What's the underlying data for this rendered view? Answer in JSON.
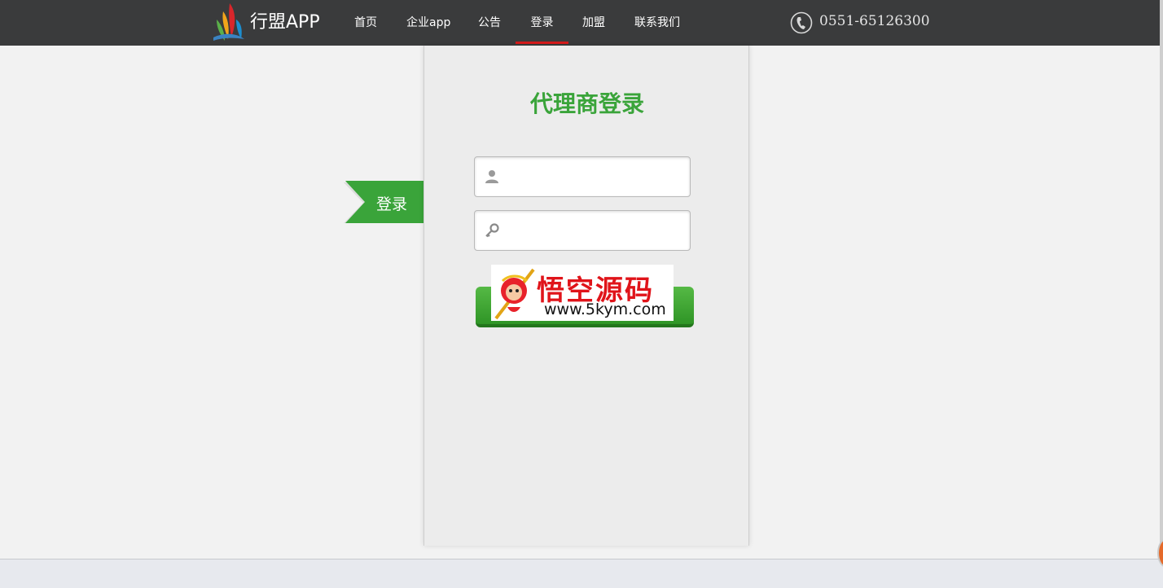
{
  "header": {
    "brand": "行盟APP",
    "nav": [
      {
        "label": "首页"
      },
      {
        "label": "企业app"
      },
      {
        "label": "公告"
      },
      {
        "label": "登录"
      },
      {
        "label": "加盟"
      },
      {
        "label": "联系我们"
      }
    ],
    "active_nav": "登录",
    "phone": "0551-65126300",
    "icons": {
      "logo": "brand-logo-icon",
      "phone": "phone-icon"
    }
  },
  "ribbon": {
    "label": "登录"
  },
  "login": {
    "title": "代理商登录",
    "username_field": {
      "value": "",
      "placeholder": "",
      "icon": "user-icon"
    },
    "password_field": {
      "value": "",
      "placeholder": "",
      "icon": "key-icon"
    }
  },
  "watermark": {
    "title": "悟空源码",
    "url": "www.5kym.com"
  },
  "colors": {
    "topbar": "#3a3b3c",
    "accent_green": "#3aa43a",
    "active_underline": "#d61b1b",
    "watermark_red": "#e0141a"
  }
}
